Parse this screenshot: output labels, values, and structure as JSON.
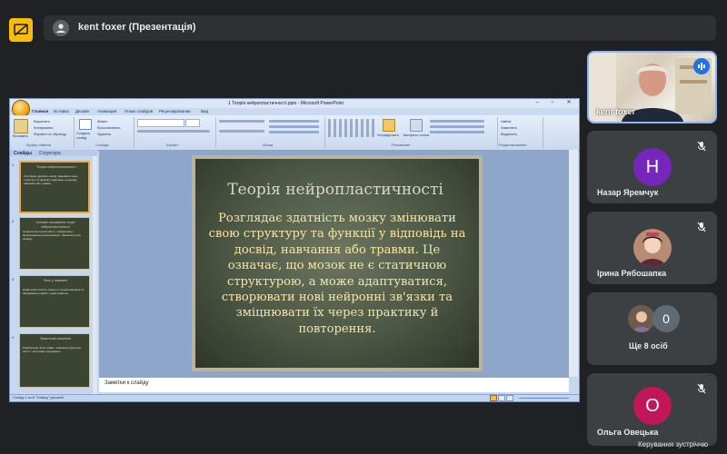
{
  "header": {
    "presenter_label": "kent foxer (Презентація)"
  },
  "ppt": {
    "window_title": "1 Теорія нейропластичності.pptx - Microsoft PowerPoint",
    "tabs": [
      "Главная",
      "Вставка",
      "Дизайн",
      "Анимация",
      "Показ слайдов",
      "Рецензирование",
      "Вид"
    ],
    "ribbon_groups": [
      "Буфер обмена",
      "Слайды",
      "Шрифт",
      "Абзац",
      "Рисование",
      "Редактирование"
    ],
    "ribbon_buttons": {
      "paste": "Вставить",
      "cut": "Вырезать",
      "copy": "Копировать",
      "format_painter": "Формат по образцу",
      "new_slide": "Создать слайд",
      "layout": "Макет",
      "reset": "Восстановить",
      "delete": "Удалить",
      "arrange": "Упорядочить",
      "quick_styles": "Экспресс-стили",
      "find": "Найти",
      "replace": "Заменить",
      "select": "Выделить"
    },
    "panel_tabs": [
      "Слайды",
      "Структура"
    ],
    "thumbnails": [
      {
        "title": "Теорія нейропластичності",
        "body": "Розглядає здатність мозку змінювати свою структуру та функції у відповідь на досвід, навчання або травми."
      },
      {
        "title": "Основні положення теорії нейропластичності",
        "body": "Синаптична пластичність • Нейрогенез • Функціональна реорганізація • Залежність від досвіду"
      },
      {
        "title": "Роль у навчанні",
        "body": "Нейропластичність лежить в основі навчання та формування пам'яті, нових навичок."
      },
      {
        "title": "Практичне значення",
        "body": "Реабілітація після травм • Навчання протягом життя • Когнітивні тренування"
      }
    ],
    "slide": {
      "title": "Теорія нейропластичності",
      "body": "Розглядає здатність мозку змінювати свою структуру та функції у відповідь на досвід, навчання або травми. Це означає, що мозок не є статичною структурою, а може адаптуватися, створювати нові нейронні зв'язки та зміцнювати їх через практику й повторення."
    },
    "notes_placeholder": "Заметки к слайду",
    "status": "Слайд 1 из 8   \"Galaxy\"   русский"
  },
  "participants": [
    {
      "name": "kent foxer",
      "type": "video",
      "speaking": true
    },
    {
      "name": "Назар Яремчук",
      "initial": "H",
      "avatar_color": "#7627bb",
      "muted": true
    },
    {
      "name": "Ірина Рябошапка",
      "initial": "",
      "avatar_color": "#b98b73",
      "muted": true
    },
    {
      "name": "Ще 8 осіб",
      "count": "0"
    },
    {
      "name": "Ольга Овецька",
      "initial": "O",
      "avatar_color": "#c1175a",
      "muted": true
    }
  ],
  "footer": {
    "caption": "Керування зустріччю"
  },
  "colors": {
    "accent": "#8ab4f8",
    "present_badge": "#fbbc04",
    "slide_text": "#f6e6a4"
  }
}
